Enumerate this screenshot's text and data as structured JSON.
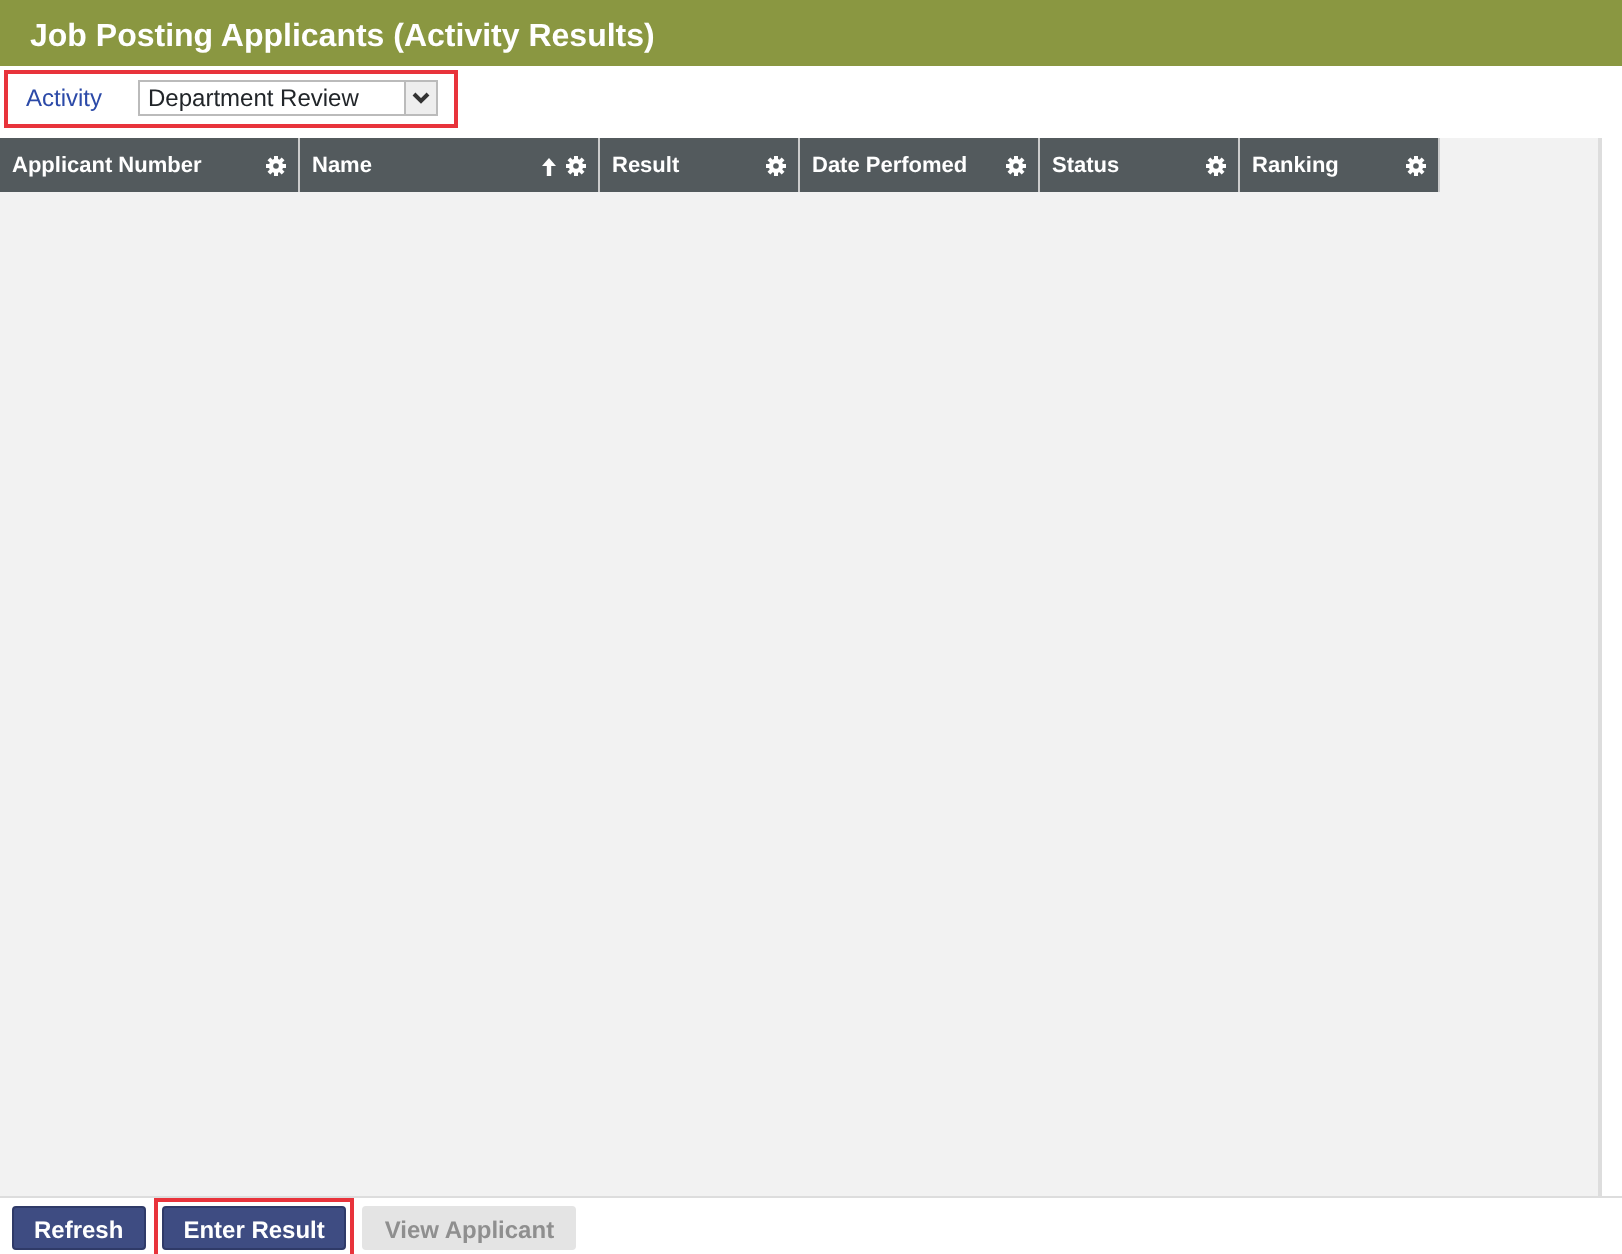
{
  "window": {
    "title": "Job Posting Applicants (Activity Results)"
  },
  "activity_filter": {
    "label": "Activity",
    "value": "Department Review",
    "highlighted": true
  },
  "table": {
    "columns": [
      {
        "label": "Applicant Number",
        "sorted": false
      },
      {
        "label": "Name",
        "sorted": true
      },
      {
        "label": "Result",
        "sorted": false
      },
      {
        "label": "Date Perfomed",
        "sorted": false
      },
      {
        "label": "Status",
        "sorted": false
      },
      {
        "label": "Ranking",
        "sorted": false
      }
    ]
  },
  "buttons": [
    {
      "label": "Refresh",
      "disabled": false,
      "highlighted": false
    },
    {
      "label": "Enter Result",
      "disabled": false,
      "highlighted": true
    },
    {
      "label": "View Applicant",
      "disabled": true,
      "highlighted": false
    }
  ]
}
